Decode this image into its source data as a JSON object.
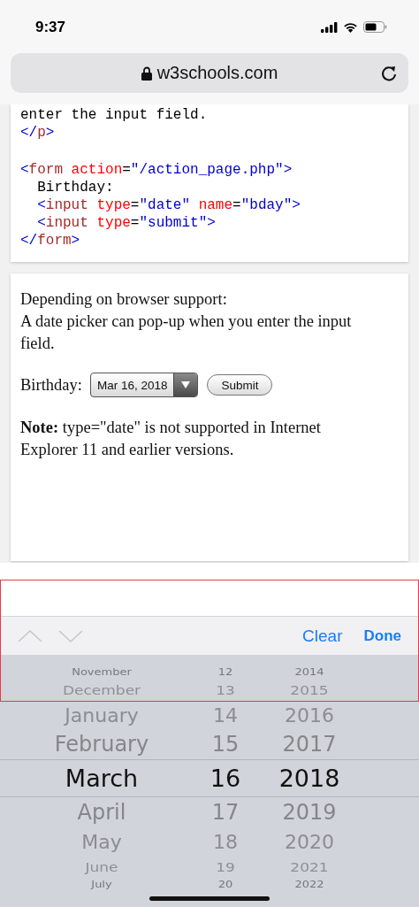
{
  "status_bar": {
    "time": "9:37"
  },
  "browser": {
    "address": "w3schools.com"
  },
  "code_lines": [
    {
      "kind": "code",
      "tokens": [
        {
          "kind": "text",
          "text": "enter the input field."
        }
      ]
    },
    {
      "kind": "code",
      "tokens": [
        {
          "kind": "bracket",
          "text": "</"
        },
        {
          "kind": "tag",
          "text": "p"
        },
        {
          "kind": "bracket",
          "text": ">"
        }
      ]
    },
    {
      "kind": "blank"
    },
    {
      "kind": "code",
      "tokens": [
        {
          "kind": "bracket",
          "text": "<"
        },
        {
          "kind": "tag",
          "text": "form"
        },
        {
          "kind": "attr",
          "text": " action"
        },
        {
          "kind": "text",
          "text": "="
        },
        {
          "kind": "value",
          "text": "\"/action_page.php\""
        },
        {
          "kind": "bracket",
          "text": ">"
        }
      ]
    },
    {
      "kind": "code",
      "tokens": [
        {
          "kind": "text",
          "text": "  Birthday:"
        }
      ]
    },
    {
      "kind": "code",
      "tokens": [
        {
          "kind": "bracket",
          "text": "  <"
        },
        {
          "kind": "tag",
          "text": "input"
        },
        {
          "kind": "attr",
          "text": " type"
        },
        {
          "kind": "text",
          "text": "="
        },
        {
          "kind": "value",
          "text": "\"date\""
        },
        {
          "kind": "attr",
          "text": " name"
        },
        {
          "kind": "text",
          "text": "="
        },
        {
          "kind": "value",
          "text": "\"bday\""
        },
        {
          "kind": "bracket",
          "text": ">"
        }
      ]
    },
    {
      "kind": "code",
      "tokens": [
        {
          "kind": "bracket",
          "text": "  <"
        },
        {
          "kind": "tag",
          "text": "input"
        },
        {
          "kind": "attr",
          "text": " type"
        },
        {
          "kind": "text",
          "text": "="
        },
        {
          "kind": "value",
          "text": "\"submit\""
        },
        {
          "kind": "bracket",
          "text": ">"
        }
      ]
    },
    {
      "kind": "code",
      "tokens": [
        {
          "kind": "bracket",
          "text": "</"
        },
        {
          "kind": "tag",
          "text": "form"
        },
        {
          "kind": "bracket",
          "text": ">"
        }
      ]
    }
  ],
  "demo": {
    "intro": [
      "Depending on browser support:",
      "A date picker can pop-up when you enter the input field."
    ],
    "field_label": "Birthday:",
    "date_value": "Mar 16, 2018",
    "submit": "Submit",
    "note": "**Note:** type=\"date\" is not supported in Internet Explorer 11 and earlier versions."
  },
  "toolbar": {
    "clear": "Clear",
    "done": "Done"
  },
  "picker": {
    "rows": [
      {
        "month": "November",
        "day": "12",
        "year": "2014",
        "selected": false
      },
      {
        "month": "December",
        "day": "13",
        "year": "2015",
        "selected": false
      },
      {
        "month": "January",
        "day": "14",
        "year": "2016",
        "selected": false
      },
      {
        "month": "February",
        "day": "15",
        "year": "2017",
        "selected": false
      },
      {
        "month": "March",
        "day": "16",
        "year": "2018",
        "selected": true
      },
      {
        "month": "April",
        "day": "17",
        "year": "2019",
        "selected": false
      },
      {
        "month": "May",
        "day": "18",
        "year": "2020",
        "selected": false
      },
      {
        "month": "June",
        "day": "19",
        "year": "2021",
        "selected": false
      },
      {
        "month": "July",
        "day": "20",
        "year": "2022",
        "selected": false
      }
    ]
  }
}
